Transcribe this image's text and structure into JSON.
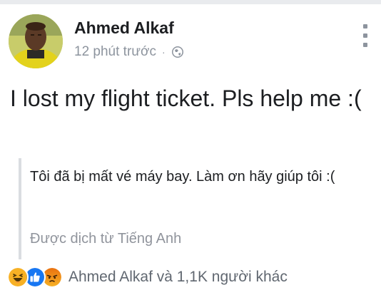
{
  "post": {
    "author": "Ahmed Alkaf",
    "time": "12 phút trước",
    "separator": "·",
    "privacy_icon": "globe-icon",
    "text": "I lost my flight ticket. Pls help me :(",
    "translation": {
      "text": "Tôi đã bị mất vé máy bay. Làm ơn hãy giúp tôi :(",
      "source_label": "Được dịch từ Tiếng Anh"
    },
    "reactions": {
      "icons": [
        "haha-icon",
        "like-icon",
        "angry-icon"
      ],
      "summary": "Ahmed Alkaf và 1,1K người khác"
    }
  },
  "colors": {
    "text_primary": "#1c1e21",
    "text_secondary": "#8d949e",
    "like_blue": "#1877f2",
    "reaction_yellow": "#f7b125",
    "angry_orange": "#e9710f"
  }
}
